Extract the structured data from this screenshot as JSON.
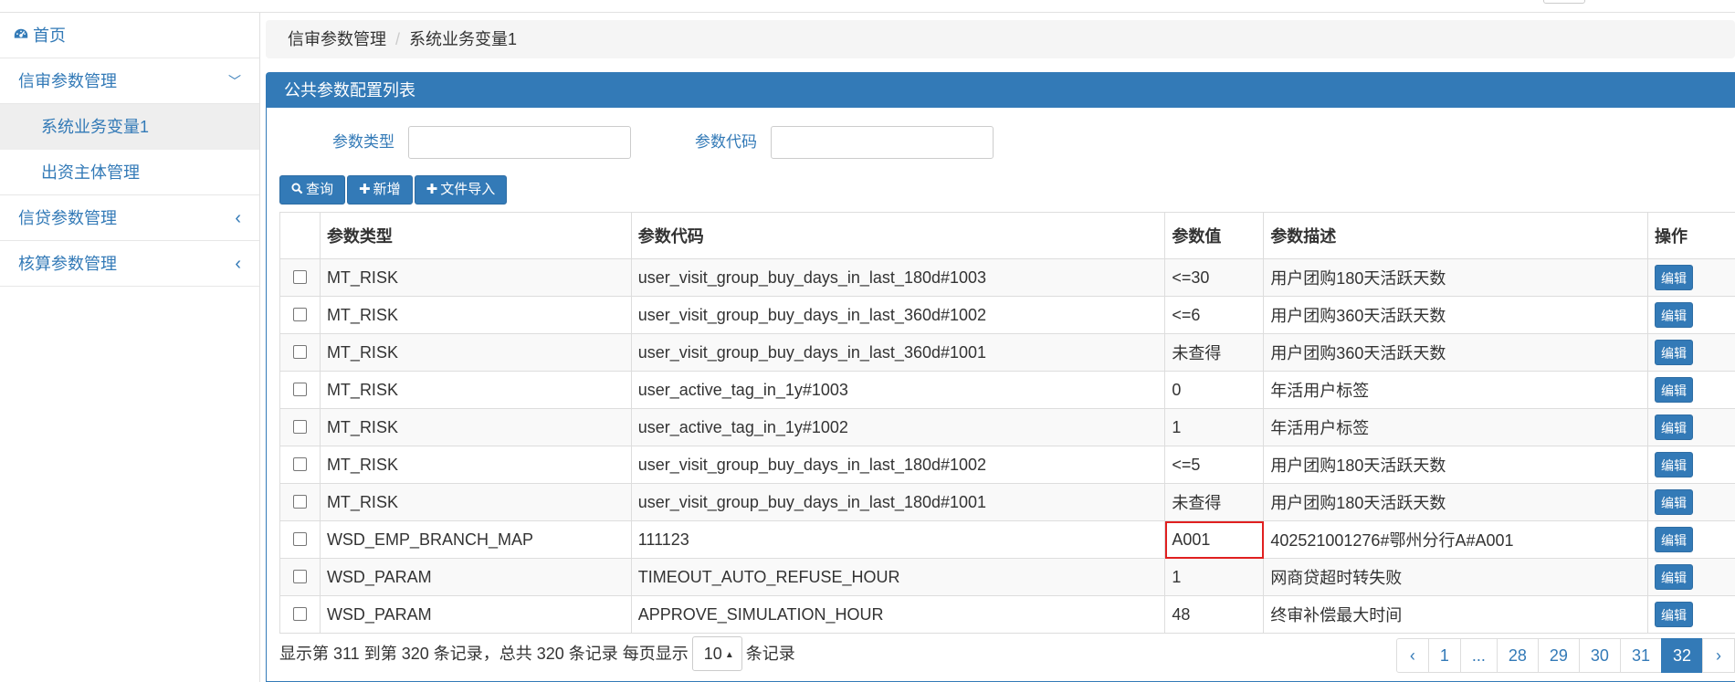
{
  "sidebar": {
    "home": "首页",
    "menu1": "信审参数管理",
    "menu1_sub1": "系统业务变量1",
    "menu1_sub2": "出资主体管理",
    "menu2": "信贷参数管理",
    "menu3": "核算参数管理",
    "chevron_down": "﹀",
    "chevron_left": "‹"
  },
  "breadcrumb": {
    "item1": "信审参数管理",
    "separator": "/",
    "item2": "系统业务变量1"
  },
  "panel": {
    "title": "公共参数配置列表"
  },
  "filters": {
    "type_label": "参数类型",
    "type_value": "",
    "code_label": "参数代码",
    "code_value": ""
  },
  "toolbar": {
    "query_label": "查询",
    "add_label": "新增",
    "import_label": "文件导入"
  },
  "table": {
    "headers": [
      "参数类型",
      "参数代码",
      "参数值",
      "参数描述",
      "操作"
    ],
    "edit_label": "编辑",
    "rows": [
      {
        "type": "MT_RISK",
        "code": "user_visit_group_buy_days_in_last_180d#1003",
        "value": "<=30",
        "desc": "用户团购180天活跃天数"
      },
      {
        "type": "MT_RISK",
        "code": "user_visit_group_buy_days_in_last_360d#1002",
        "value": "<=6",
        "desc": "用户团购360天活跃天数"
      },
      {
        "type": "MT_RISK",
        "code": "user_visit_group_buy_days_in_last_360d#1001",
        "value": "未查得",
        "desc": "用户团购360天活跃天数"
      },
      {
        "type": "MT_RISK",
        "code": "user_active_tag_in_1y#1003",
        "value": "0",
        "desc": "年活用户标签"
      },
      {
        "type": "MT_RISK",
        "code": "user_active_tag_in_1y#1002",
        "value": "1",
        "desc": "年活用户标签"
      },
      {
        "type": "MT_RISK",
        "code": "user_visit_group_buy_days_in_last_180d#1002",
        "value": "<=5",
        "desc": "用户团购180天活跃天数"
      },
      {
        "type": "MT_RISK",
        "code": "user_visit_group_buy_days_in_last_180d#1001",
        "value": "未查得",
        "desc": "用户团购180天活跃天数"
      },
      {
        "type": "WSD_EMP_BRANCH_MAP",
        "code": "111123",
        "value": "A001",
        "desc": "402521001276#鄂州分行A#A001"
      },
      {
        "type": "WSD_PARAM",
        "code": "TIMEOUT_AUTO_REFUSE_HOUR",
        "value": "1",
        "desc": "网商贷超时转失败"
      },
      {
        "type": "WSD_PARAM",
        "code": "APPROVE_SIMULATION_HOUR",
        "value": "48",
        "desc": "终审补偿最大时间"
      }
    ]
  },
  "footer": {
    "summary": "显示第 311 到第 320 条记录，总共 320 条记录 每页显示",
    "page_size": "10",
    "suffix": "条记录"
  },
  "pagination": {
    "prev": "‹",
    "pages": [
      "1",
      "...",
      "28",
      "29",
      "30",
      "31",
      "32"
    ],
    "active": "32",
    "next": "›"
  },
  "colors": {
    "primary": "#337ab7",
    "highlight_border": "#e02020"
  }
}
